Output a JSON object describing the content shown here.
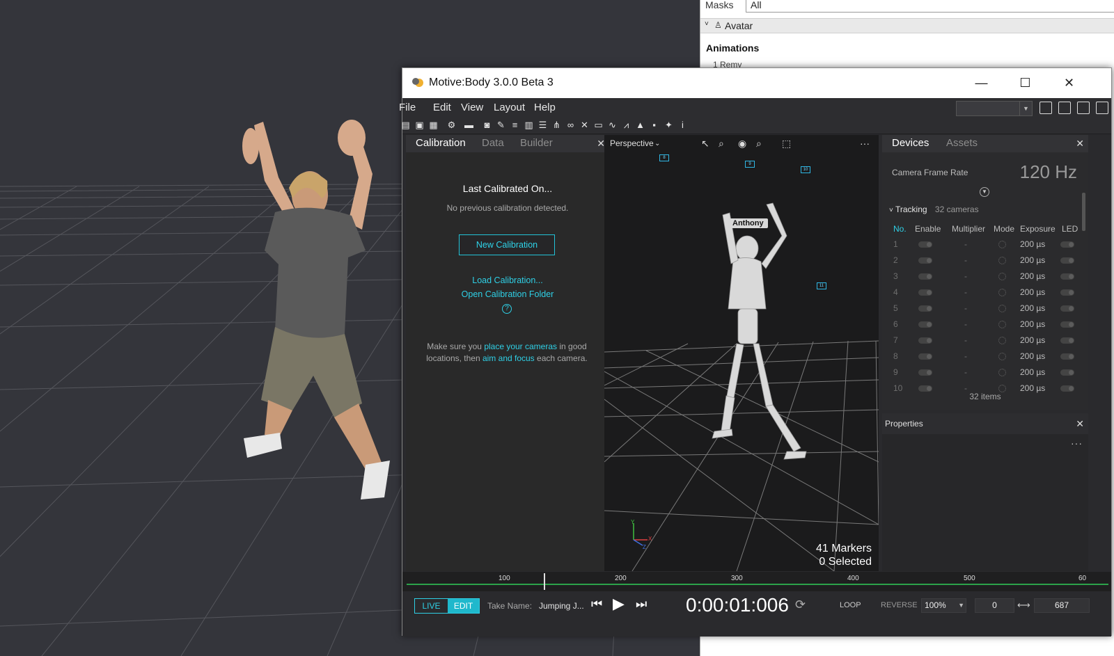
{
  "background_app": {
    "masks_label": "Masks",
    "masks_value": "All",
    "avatar_label": "Avatar",
    "animations_title": "Animations",
    "animation_item": "1   Remy"
  },
  "window": {
    "title": "Motive:Body 3.0.0 Beta 3",
    "minimize": "—",
    "maximize": "☐",
    "close": "✕"
  },
  "menu": [
    "File",
    "Edit",
    "View",
    "Layout",
    "Help"
  ],
  "calibration": {
    "tabs": [
      "Calibration",
      "Data",
      "Builder"
    ],
    "heading": "Last Calibrated On...",
    "subtitle": "No previous calibration detected.",
    "new_button": "New Calibration",
    "load_link": "Load Calibration...",
    "open_link": "Open Calibration Folder",
    "help": "?",
    "note_pre": "Make sure you ",
    "note_link1": "place your cameras",
    "note_mid": " in good locations, then ",
    "note_link2": "aim and focus",
    "note_post": " each camera."
  },
  "viewport": {
    "view_mode": "Perspective",
    "subject_label": "Anthony",
    "markers": "41 Markers",
    "selected": "0 Selected",
    "camera_tags": [
      "8",
      "9",
      "10",
      "11"
    ],
    "axis_y": "Y",
    "axis_x": "X",
    "axis_z": "Z"
  },
  "devices": {
    "tabs": [
      "Devices",
      "Assets"
    ],
    "frame_rate_label": "Camera Frame Rate",
    "frame_rate_value": "120 Hz",
    "tracking_label": "Tracking",
    "tracking_count": "32 cameras",
    "columns": [
      "No.",
      "Enable",
      "Multiplier",
      "Mode",
      "Exposure",
      "LED"
    ],
    "rows": [
      {
        "no": "1",
        "multiplier": "-",
        "exposure": "200 µs"
      },
      {
        "no": "2",
        "multiplier": "-",
        "exposure": "200 µs"
      },
      {
        "no": "3",
        "multiplier": "-",
        "exposure": "200 µs"
      },
      {
        "no": "4",
        "multiplier": "-",
        "exposure": "200 µs"
      },
      {
        "no": "5",
        "multiplier": "-",
        "exposure": "200 µs"
      },
      {
        "no": "6",
        "multiplier": "-",
        "exposure": "200 µs"
      },
      {
        "no": "7",
        "multiplier": "-",
        "exposure": "200 µs"
      },
      {
        "no": "8",
        "multiplier": "-",
        "exposure": "200 µs"
      },
      {
        "no": "9",
        "multiplier": "-",
        "exposure": "200 µs"
      },
      {
        "no": "10",
        "multiplier": "-",
        "exposure": "200 µs"
      }
    ],
    "footer": "32 items"
  },
  "properties": {
    "title": "Properties",
    "more": "···"
  },
  "timeline": {
    "ticks": [
      "100",
      "200",
      "300",
      "400",
      "500",
      "60"
    ]
  },
  "transport": {
    "live": "LIVE",
    "edit": "EDIT",
    "take_label": "Take Name:",
    "take_value": "Jumping J...",
    "timecode": "0:00:01:006",
    "loop": "LOOP",
    "reverse": "REVERSE",
    "speed": "100%",
    "range_start": "0",
    "range_end": "687"
  },
  "colors": {
    "accent": "#2fd0e6",
    "timeline_green": "#2ca24a",
    "panel_bg": "#2b2b2d"
  }
}
